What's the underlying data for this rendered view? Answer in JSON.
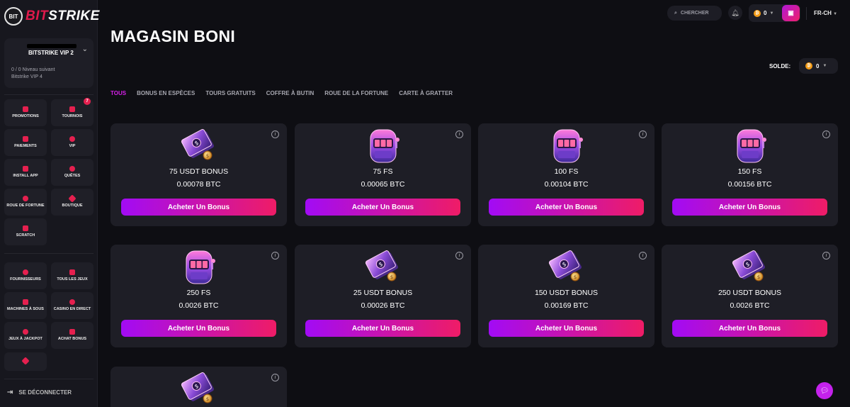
{
  "brand": {
    "badge": "BIT",
    "name_part1": "BIT",
    "name_part2": "STRIKE"
  },
  "vip": {
    "title": "BITSTRIKE VIP 2",
    "progress": "0 / 0 Niveau suivant",
    "next": "Bitstrike VIP 4"
  },
  "sidebar": {
    "tiles1": [
      {
        "label": "PROMOTIONS",
        "badge": ""
      },
      {
        "label": "TOURNOIS",
        "badge": "7"
      },
      {
        "label": "PAIEMENTS",
        "badge": ""
      },
      {
        "label": "VIP",
        "badge": ""
      },
      {
        "label": "INSTALL APP",
        "badge": ""
      },
      {
        "label": "QUÊTES",
        "badge": ""
      },
      {
        "label": "ROUE DE FORTUNE",
        "badge": ""
      },
      {
        "label": "BOUTIQUE",
        "badge": ""
      },
      {
        "label": "SCRATCH",
        "badge": ""
      }
    ],
    "tiles2": [
      {
        "label": "FOURNISSEURS"
      },
      {
        "label": "TOUS LES JEUX"
      },
      {
        "label": "MACHINES À SOUS"
      },
      {
        "label": "CASINO EN DIRECT"
      },
      {
        "label": "JEUX À JACKPOT"
      },
      {
        "label": "ACHAT BONUS"
      },
      {
        "label": ""
      }
    ],
    "logout": "SE DÉCONNECTER"
  },
  "header": {
    "search_label": "CHERCHER",
    "balance": "0",
    "lang": "FR-CH"
  },
  "main": {
    "title": "MAGASIN BONI",
    "solde_label": "SOLDE:",
    "solde_value": "0",
    "tabs": [
      "TOUS",
      "BONUS EN ESPÈCES",
      "TOURS GRATUITS",
      "COFFRE À BUTIN",
      "ROUE DE LA FORTUNE",
      "CARTE À GRATTER"
    ],
    "buy_label": "Acheter Un Bonus",
    "cards": [
      {
        "name": "75 USDT BONUS",
        "price": "0.00078 BTC",
        "icon": "cash-stack-icon"
      },
      {
        "name": "75 FS",
        "price": "0.00065 BTC",
        "icon": "slot-machine-icon"
      },
      {
        "name": "100 FS",
        "price": "0.00104 BTC",
        "icon": "slot-machine-icon"
      },
      {
        "name": "150 FS",
        "price": "0.00156 BTC",
        "icon": "slot-machine-icon"
      },
      {
        "name": "250 FS",
        "price": "0.0026 BTC",
        "icon": "slot-machine-icon"
      },
      {
        "name": "25 USDT BONUS",
        "price": "0.00026 BTC",
        "icon": "cash-stack-icon"
      },
      {
        "name": "150 USDT BONUS",
        "price": "0.00169 BTC",
        "icon": "cash-stack-icon"
      },
      {
        "name": "250 USDT BONUS",
        "price": "0.0026 BTC",
        "icon": "cash-stack-icon"
      },
      {
        "name": "",
        "price": "",
        "icon": "cash-stack-icon"
      }
    ]
  },
  "colors": {
    "accent_pink": "#ef1f6a",
    "accent_purple": "#a20bf5",
    "brand_red": "#e0194b",
    "coin": "#f39c18"
  }
}
